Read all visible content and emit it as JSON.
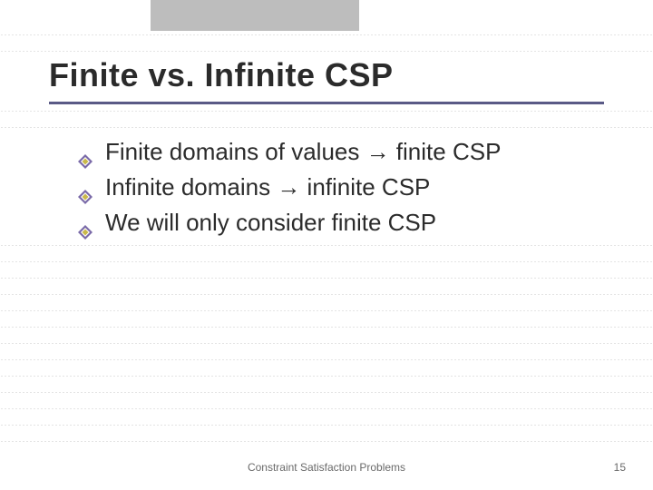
{
  "title": "Finite vs. Infinite CSP",
  "bullets": [
    "Finite domains of values → finite CSP",
    "Infinite domains → infinite CSP",
    "We will only consider finite CSP"
  ],
  "footer": {
    "center": "Constraint Satisfaction Problems",
    "page": "15"
  },
  "colors": {
    "bullet_outer": "#7a6aa8",
    "bullet_inner": "#c9b84a",
    "title_rule": "#5a5a86",
    "tab": "#bdbdbd"
  }
}
